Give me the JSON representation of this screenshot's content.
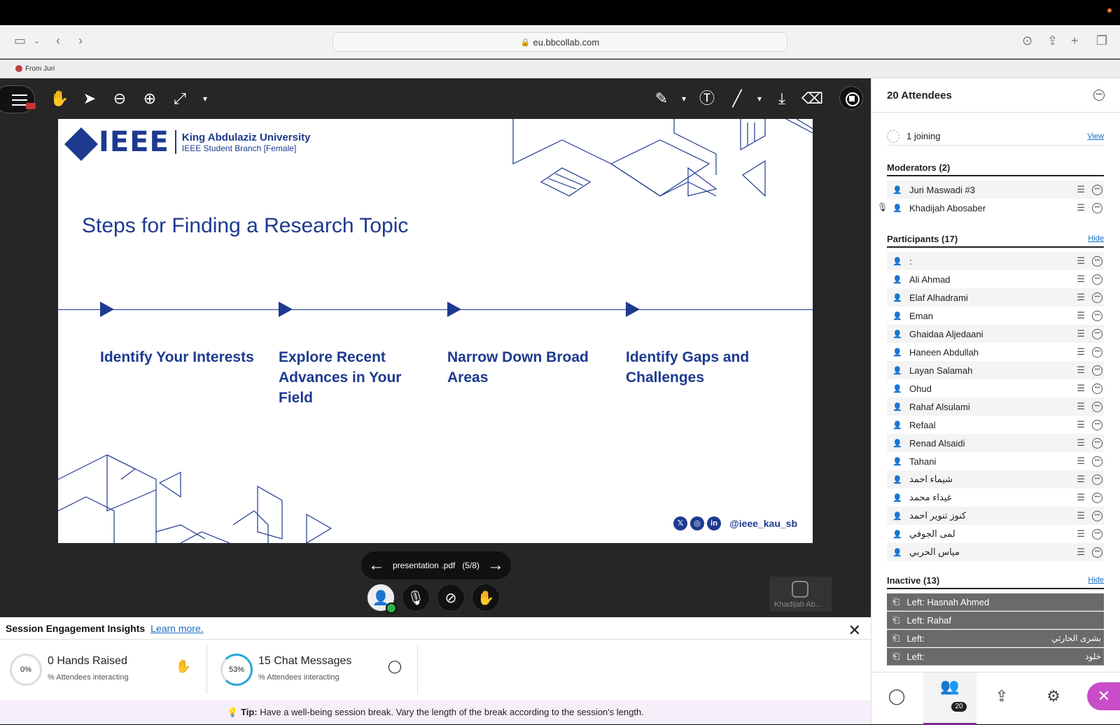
{
  "browser": {
    "url": "eu.bbcollab.com",
    "favorite": "From Juri"
  },
  "slide": {
    "logo_word": "IEEE",
    "org": "King Abdulaziz University",
    "branch": "IEEE Student Branch [Female]",
    "title": "Steps for Finding a Research Topic",
    "steps": [
      "Identify Your Interests",
      "Explore Recent Advances in Your Field",
      "Narrow Down Broad Areas",
      "Identify Gaps and Challenges"
    ],
    "handle": "@ieee_kau_sb",
    "social_icons": [
      "x-icon",
      "instagram-icon",
      "linkedin-icon"
    ]
  },
  "pager": {
    "label": "presentation .pdf",
    "page": "(5/8)"
  },
  "share_tile": {
    "name": "Khadijah Ab..."
  },
  "insights": {
    "title": "Session Engagement Insights",
    "learn_more": "Learn more.",
    "hands": {
      "pct": "0%",
      "label": "0 Hands Raised",
      "sub": "% Attendees interacting"
    },
    "chat": {
      "pct": "53%",
      "label": "15 Chat Messages",
      "sub": "% Attendees interacting"
    }
  },
  "tip": {
    "prefix": "Tip:",
    "text": "Have a well-being session break. Vary the length of the break according to the session's length."
  },
  "panel": {
    "title": "20 Attendees",
    "joining": "1 joining",
    "view": "View",
    "moderators_label": "Moderators (2)",
    "moderators": [
      "Juri Maswadi #3",
      "Khadijah Abosaber"
    ],
    "participants_label": "Participants (17)",
    "hide": "Hide",
    "participants": [
      ":",
      "Ali Ahmad",
      "Elaf Alhadrami",
      "Eman",
      "Ghaidaa Aljedaani",
      "Haneen Abdullah",
      "Layan Salamah",
      "Ohud",
      "Rahaf Alsulami",
      "Refaal",
      "Renad Alsaidi",
      "Tahani",
      "شيماء احمد",
      "غيداء محمد",
      "كنوز تنوير احمد",
      "لمى الجوفي",
      "مياس الحربي"
    ],
    "inactive_label": "Inactive (13)",
    "inactive": [
      {
        "prefix": "Left:",
        "name": "Hasnah Ahmed",
        "tail": ""
      },
      {
        "prefix": "Left:",
        "name": "Rahaf",
        "tail": ""
      },
      {
        "prefix": "Left:",
        "name": "",
        "tail": "بشرى الحارثي"
      },
      {
        "prefix": "Left:",
        "name": "",
        "tail": "خلود"
      }
    ],
    "badge": "20"
  },
  "colors": {
    "brand": "#1d3a8f",
    "accent": "#c94dc9",
    "link": "#1a6cc2"
  }
}
